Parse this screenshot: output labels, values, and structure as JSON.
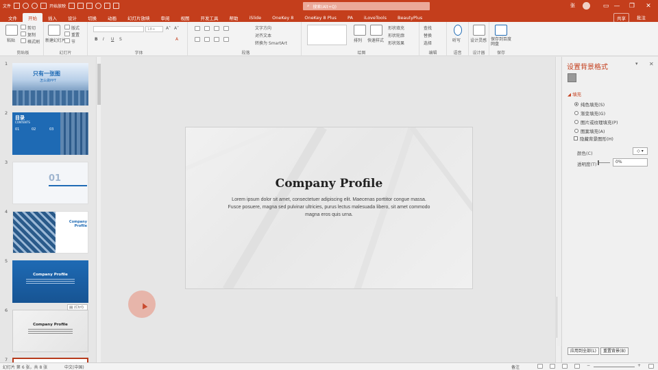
{
  "titlebar": {
    "qat_labels": [
      "文件",
      "保存",
      "撤销",
      "恢复",
      "开始放映",
      "格式刷",
      "选择窗格",
      "形状"
    ],
    "search_placeholder": "搜索(Alt+Q)",
    "user_name": "张",
    "minimize": "—",
    "restore": "❐",
    "close": "✕"
  },
  "tabs": [
    "文件",
    "开始",
    "插入",
    "设计",
    "切换",
    "动画",
    "幻灯片放映",
    "审阅",
    "视图",
    "开发工具",
    "帮助",
    "iSlide",
    "OneKey 8",
    "OneKey 8 Plus",
    "PA",
    "iLoveTools",
    "BeautyPlus"
  ],
  "active_tab": 1,
  "share_label": "共享",
  "comment_label": "批注",
  "ribbon": {
    "groups": [
      {
        "label": "剪贴板",
        "items": [
          "粘贴",
          "剪切",
          "复制",
          "格式刷"
        ]
      },
      {
        "label": "幻灯片",
        "items": [
          "新建幻灯片",
          "版式",
          "重置",
          "节"
        ]
      },
      {
        "label": "字体",
        "items": [
          "B",
          "I",
          "U",
          "S",
          "A"
        ]
      },
      {
        "label": "段落",
        "items": [
          "文字方向",
          "对齐文本",
          "转换为 SmartArt"
        ]
      },
      {
        "label": "绘图",
        "items": [
          "排列",
          "快速样式",
          "形状填充",
          "形状轮廓",
          "形状效果"
        ]
      },
      {
        "label": "编辑",
        "items": [
          "查找",
          "替换",
          "选择"
        ]
      },
      {
        "label": "语音",
        "items": [
          "听写"
        ]
      },
      {
        "label": "设计器",
        "items": [
          "设计灵感"
        ]
      },
      {
        "label": "保存",
        "items": [
          "保存到百度网盘"
        ]
      }
    ],
    "font_name_placeholder": "",
    "font_size_placeholder": "18+"
  },
  "slides": [
    {
      "num": "1",
      "title": "只有一张图",
      "subtitle": "怎么做PPT"
    },
    {
      "num": "2",
      "title": "目录",
      "subtitle": "CONTENTS",
      "items": [
        "01",
        "02",
        "03"
      ]
    },
    {
      "num": "3",
      "title": "01",
      "subtitle": ""
    },
    {
      "num": "4",
      "title": "Company Profile",
      "subtitle": ""
    },
    {
      "num": "5",
      "title": "Company Profile",
      "subtitle": ""
    },
    {
      "num": "6",
      "title": "Company Profile",
      "subtitle": ""
    },
    {
      "num": "7",
      "title": "",
      "subtitle": ""
    }
  ],
  "paste_tag": "(Ctrl)",
  "main_slide": {
    "title": "Company Profile",
    "body": "Lorem ipsum dolor sit amet, consectetuer adipiscing elit. Maecenas porttitor congue massa. Fusce posuere, magna sed pulvinar ultricies, purus lectus malesuada libero, sit amet commodo magna eros quis urna."
  },
  "format_pane": {
    "title": "设置背景格式",
    "section": "填充",
    "options": [
      {
        "label": "纯色填充(S)",
        "type": "radio",
        "checked": true
      },
      {
        "label": "渐变填充(G)",
        "type": "radio",
        "checked": false
      },
      {
        "label": "图片或纹理填充(P)",
        "type": "radio",
        "checked": false
      },
      {
        "label": "图案填充(A)",
        "type": "radio",
        "checked": false
      },
      {
        "label": "隐藏背景图形(H)",
        "type": "checkbox",
        "checked": false
      }
    ],
    "color_label": "颜色(C)",
    "transparency_label": "透明度(T)",
    "transparency_value": "0%",
    "apply_all": "应用到全部(L)",
    "reset": "重置背景(B)"
  },
  "statusbar": {
    "slide_info": "幻灯片 第 6 张，共 8 张",
    "language": "中文(中国)",
    "notes": "备注",
    "zoom": ""
  },
  "colors": {
    "accent": "#c43e1c",
    "slide_blue": "#1e6ab4"
  }
}
